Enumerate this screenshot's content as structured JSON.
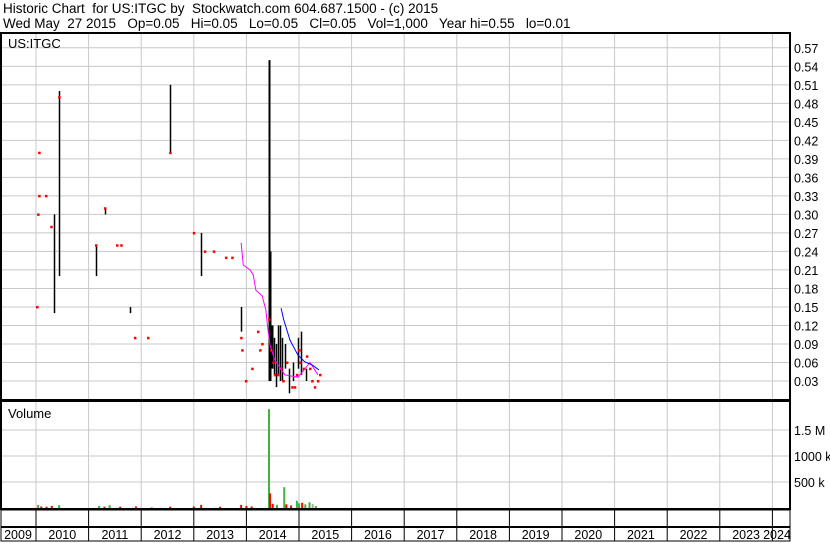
{
  "header": {
    "line1": "Historic Chart  for US:ITGC by  Stockwatch.com 604.687.1500 - (c) 2015",
    "line2": "Wed May  27 2015   Op=0.05   Hi=0.05   Lo=0.05   Cl=0.05   Vol=1,000   Year hi=0.55   lo=0.01"
  },
  "chart_data": [
    {
      "type": "line",
      "title": "US:ITGC",
      "ylim": [
        0,
        0.585
      ],
      "xlim": [
        2009.32,
        2024.36
      ],
      "y_ticks": [
        "0.57",
        "0.54",
        "0.51",
        "0.48",
        "0.45",
        "0.42",
        "0.39",
        "0.36",
        "0.33",
        "0.30",
        "0.27",
        "0.24",
        "0.21",
        "0.18",
        "0.15",
        "0.12",
        "0.09",
        "0.06",
        "0.03"
      ],
      "y_tick_values": [
        0.57,
        0.54,
        0.51,
        0.48,
        0.45,
        0.42,
        0.39,
        0.36,
        0.33,
        0.3,
        0.27,
        0.24,
        0.21,
        0.18,
        0.15,
        0.12,
        0.09,
        0.06,
        0.03
      ],
      "grid": true,
      "price_bars": [
        [
          2010.34,
          0.14,
          0.3
        ],
        [
          2010.44,
          0.2,
          0.5
        ],
        [
          2011.14,
          0.2,
          0.25
        ],
        [
          2011.31,
          0.3,
          0.31
        ],
        [
          2011.79,
          0.14,
          0.15
        ],
        [
          2012.55,
          0.4,
          0.51
        ],
        [
          2013.14,
          0.2,
          0.27
        ],
        [
          2013.9,
          0.11,
          0.15
        ],
        [
          2014.43,
          0.03,
          0.55
        ],
        [
          2014.45,
          0.03,
          0.24
        ],
        [
          2014.49,
          0.05,
          0.12
        ],
        [
          2014.53,
          0.04,
          0.1
        ],
        [
          2014.56,
          0.02,
          0.09
        ],
        [
          2014.6,
          0.04,
          0.12
        ],
        [
          2014.64,
          0.03,
          0.12
        ],
        [
          2014.68,
          0.03,
          0.1
        ],
        [
          2014.73,
          0.05,
          0.09
        ],
        [
          2014.81,
          0.01,
          0.05
        ],
        [
          2014.89,
          0.03,
          0.06
        ],
        [
          2014.98,
          0.05,
          0.1
        ],
        [
          2015.04,
          0.04,
          0.11
        ],
        [
          2015.13,
          0.03,
          0.05
        ]
      ],
      "close_points": [
        [
          2010.02,
          0.15
        ],
        [
          2010.06,
          0.4
        ],
        [
          2010.06,
          0.33
        ],
        [
          2010.19,
          0.33
        ],
        [
          2010.04,
          0.3
        ],
        [
          2010.29,
          0.28
        ],
        [
          2010.44,
          0.49
        ],
        [
          2011.31,
          0.31
        ],
        [
          2011.14,
          0.25
        ],
        [
          2011.54,
          0.25
        ],
        [
          2011.62,
          0.25
        ],
        [
          2011.88,
          0.1
        ],
        [
          2012.13,
          0.1
        ],
        [
          2012.55,
          0.4
        ],
        [
          2013.0,
          0.27
        ],
        [
          2013.21,
          0.24
        ],
        [
          2013.38,
          0.24
        ],
        [
          2013.61,
          0.23
        ],
        [
          2013.73,
          0.23
        ],
        [
          2013.9,
          0.1
        ],
        [
          2013.92,
          0.08
        ],
        [
          2013.99,
          0.03
        ],
        [
          2014.11,
          0.05
        ],
        [
          2014.22,
          0.11
        ],
        [
          2014.26,
          0.08
        ],
        [
          2014.3,
          0.09
        ],
        [
          2014.43,
          0.13
        ],
        [
          2014.47,
          0.08
        ],
        [
          2014.51,
          0.06
        ],
        [
          2014.54,
          0.04
        ],
        [
          2014.6,
          0.04
        ],
        [
          2014.66,
          0.05
        ],
        [
          2014.7,
          0.03
        ],
        [
          2014.77,
          0.06
        ],
        [
          2014.87,
          0.02
        ],
        [
          2014.92,
          0.02
        ],
        [
          2014.96,
          0.04
        ],
        [
          2015.02,
          0.06
        ],
        [
          2015.09,
          0.05
        ],
        [
          2015.15,
          0.07
        ],
        [
          2015.21,
          0.05
        ],
        [
          2015.25,
          0.03
        ],
        [
          2015.3,
          0.02
        ],
        [
          2015.36,
          0.03
        ],
        [
          2015.4,
          0.04
        ],
        [
          2015.0,
          0.08
        ]
      ],
      "series": [
        {
          "name": "moving-average-long",
          "color": "#ff00ff",
          "points": [
            [
              2013.9,
              0.254
            ],
            [
              2013.94,
              0.218
            ],
            [
              2014.07,
              0.21
            ],
            [
              2014.13,
              0.202
            ],
            [
              2014.18,
              0.177
            ],
            [
              2014.3,
              0.168
            ],
            [
              2014.37,
              0.145
            ],
            [
              2014.41,
              0.113
            ],
            [
              2014.45,
              0.088
            ],
            [
              2014.54,
              0.064
            ],
            [
              2014.73,
              0.04
            ],
            [
              2014.98,
              0.036
            ],
            [
              2015.21,
              0.06
            ],
            [
              2015.36,
              0.04
            ]
          ]
        },
        {
          "name": "moving-average-short",
          "color": "#0000ff",
          "points": [
            [
              2014.66,
              0.148
            ],
            [
              2014.71,
              0.129
            ],
            [
              2014.83,
              0.096
            ],
            [
              2014.98,
              0.072
            ],
            [
              2015.11,
              0.061
            ],
            [
              2015.25,
              0.056
            ],
            [
              2015.38,
              0.048
            ]
          ]
        }
      ],
      "colors": {
        "bar": "#000000",
        "close": "#ff0000",
        "grid": "#c8c8c8"
      }
    },
    {
      "type": "bar",
      "title": "Volume",
      "ylim": [
        0,
        2000000
      ],
      "y_ticks": [
        "1.5 M",
        "1000 k",
        "500 k"
      ],
      "y_tick_values": [
        1500000,
        1000000,
        500000
      ],
      "bars": [
        [
          2010.04,
          60000,
          "#3cb43c"
        ],
        [
          2010.1,
          30000,
          "#ff0000"
        ],
        [
          2010.2,
          25000,
          "#ff0000"
        ],
        [
          2010.3,
          40000,
          "#ff0000"
        ],
        [
          2010.44,
          55000,
          "#3cb43c"
        ],
        [
          2011.2,
          40000,
          "#3cb43c"
        ],
        [
          2011.3,
          25000,
          "#ff0000"
        ],
        [
          2011.4,
          55000,
          "#3cb43c"
        ],
        [
          2011.6,
          25000,
          "#ff0000"
        ],
        [
          2011.9,
          30000,
          "#ff0000"
        ],
        [
          2012.2,
          20000,
          "#aaaaaa"
        ],
        [
          2012.55,
          25000,
          "#ff0000"
        ],
        [
          2013.0,
          30000,
          "#ff0000"
        ],
        [
          2013.14,
          60000,
          "#ff0000"
        ],
        [
          2013.5,
          25000,
          "#ff0000"
        ],
        [
          2013.9,
          60000,
          "#ff0000"
        ],
        [
          2014.0,
          40000,
          "#ff0000"
        ],
        [
          2014.1,
          30000,
          "#ff0000"
        ],
        [
          2014.43,
          1900000,
          "#3cb43c"
        ],
        [
          2014.45,
          280000,
          "#ff0000"
        ],
        [
          2014.5,
          80000,
          "#ff0000"
        ],
        [
          2014.58,
          60000,
          "#3cb43c"
        ],
        [
          2014.72,
          400000,
          "#3cb43c"
        ],
        [
          2014.76,
          70000,
          "#ff0000"
        ],
        [
          2014.85,
          50000,
          "#ff0000"
        ],
        [
          2014.96,
          140000,
          "#3cb43c"
        ],
        [
          2015.0,
          90000,
          "#3cb43c"
        ],
        [
          2015.06,
          100000,
          "#ff0000"
        ],
        [
          2015.12,
          70000,
          "#3cb43c"
        ],
        [
          2015.2,
          110000,
          "#3cb43c"
        ],
        [
          2015.26,
          80000,
          "#aaaaaa"
        ],
        [
          2015.32,
          40000,
          "#3cb43c"
        ]
      ]
    },
    {
      "type": "axis",
      "x_ticks": [
        "2009",
        "2010",
        "2011",
        "2012",
        "2013",
        "2014",
        "2015",
        "2016",
        "2017",
        "2018",
        "2019",
        "2020",
        "2021",
        "2022",
        "2023",
        "2024"
      ]
    }
  ]
}
